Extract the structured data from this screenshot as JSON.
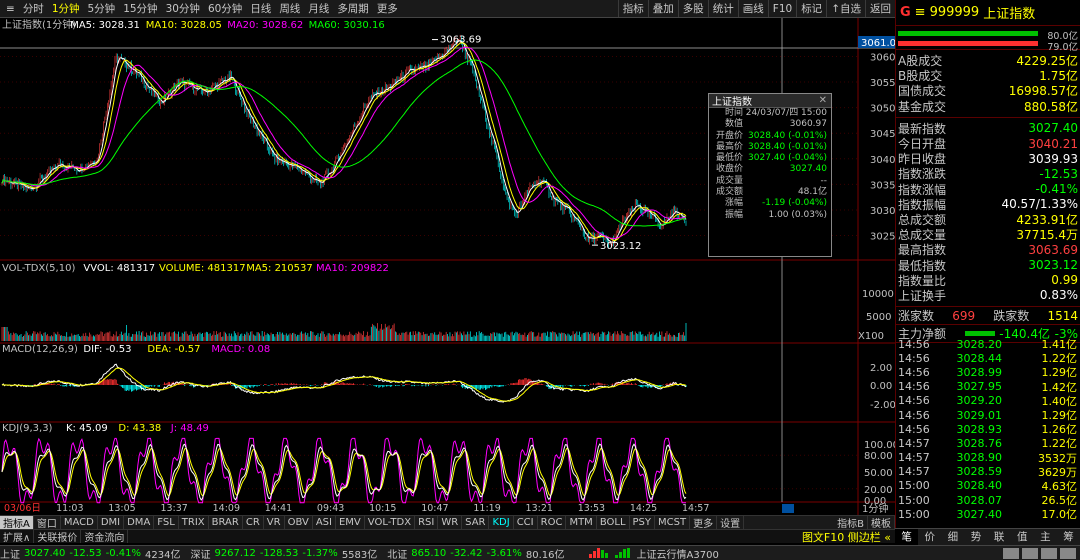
{
  "toolbar": {
    "menu_icon": "≡",
    "left": [
      "分时",
      "1分钟",
      "5分钟",
      "15分钟",
      "30分钟",
      "60分钟",
      "日线",
      "周线",
      "月线",
      "多周期",
      "更多"
    ],
    "active_index": 1,
    "right": [
      "指标",
      "叠加",
      "多股",
      "统计",
      "画线",
      "F10",
      "标记",
      "↑自选",
      "返回"
    ]
  },
  "main_legend": {
    "name": "上证指数(1分钟)",
    "ma5": "MA5: 3028.31",
    "ma10": "MA10: 3028.05",
    "ma20": "MA20: 3028.62",
    "ma60": "MA60: 3030.16"
  },
  "price_axis": {
    "ticks": [
      "3060",
      "3055",
      "3050",
      "3045",
      "3040",
      "3035",
      "3030",
      "3025"
    ],
    "highlight": "3061.0",
    "high_label": "3063.69",
    "low_label": "3023.12"
  },
  "vol_legend": {
    "name": "VOL-TDX(5,10)",
    "vvol": "VVOL: 481317",
    "volume": "VOLUME: 481317",
    "ma5": "MA5: 210537",
    "ma10": "MA10: 209822",
    "ticks": [
      "10000",
      "5000"
    ],
    "unit": "X100"
  },
  "macd_legend": {
    "name": "MACD(12,26,9)",
    "dif": "DIF: -0.53",
    "dea": "DEA: -0.57",
    "macd": "MACD: 0.08",
    "ticks": [
      "2.00",
      "0.00",
      "-2.00"
    ]
  },
  "kdj_legend": {
    "name": "KDJ(9,3,3)",
    "k": "K: 45.09",
    "d": "D: 43.38",
    "j": "J: 48.49",
    "ticks": [
      "100.00",
      "80.00",
      "50.00",
      "20.00",
      "0.00"
    ]
  },
  "time_axis": [
    "03/06日",
    "11:03",
    "13:05",
    "13:37",
    "14:09",
    "14:41",
    "09:43",
    "10:15",
    "10:47",
    "11:19",
    "13:21",
    "13:53",
    "14:25",
    "14:57"
  ],
  "period_label": "1分钟",
  "popup": {
    "title": "上证指数",
    "close": "✕",
    "rows": [
      {
        "k": "时间",
        "v": "24/03/07/四 15:00",
        "c": ""
      },
      {
        "k": "数值",
        "v": "3060.97",
        "c": ""
      },
      {
        "k": "开盘价",
        "v": "3028.40 (-0.01%)",
        "c": "g"
      },
      {
        "k": "最高价",
        "v": "3028.40 (-0.01%)",
        "c": "g"
      },
      {
        "k": "最低价",
        "v": "3027.40 (-0.04%)",
        "c": "g"
      },
      {
        "k": "收盘价",
        "v": "3027.40",
        "c": "g"
      },
      {
        "k": "成交量",
        "v": "--",
        "c": ""
      },
      {
        "k": "成交额",
        "v": "48.1亿",
        "c": ""
      },
      {
        "k": "涨幅",
        "v": "-1.19 (-0.04%)",
        "c": "g"
      },
      {
        "k": "振幅",
        "v": "1.00 (0.03%)",
        "c": ""
      }
    ]
  },
  "right_panel": {
    "badge": "G",
    "menu": "≡",
    "code": "999999",
    "name": "上证指数",
    "bar_pct_top": "80.0亿",
    "bar_pct_bottom": "79.0亿",
    "block1": [
      {
        "k": "A股成交",
        "v": "4229.25亿",
        "c": "yel"
      },
      {
        "k": "B股成交",
        "v": "1.75亿",
        "c": "yel"
      },
      {
        "k": "国债成交",
        "v": "16998.57亿",
        "c": "yel"
      },
      {
        "k": "基金成交",
        "v": "880.58亿",
        "c": "yel"
      }
    ],
    "block2": [
      {
        "k": "最新指数",
        "v": "3027.40",
        "c": "green"
      },
      {
        "k": "今日开盘",
        "v": "3040.21",
        "c": "red"
      },
      {
        "k": "昨日收盘",
        "v": "3039.93",
        "c": "white"
      },
      {
        "k": "指数涨跌",
        "v": "-12.53",
        "c": "green"
      },
      {
        "k": "指数涨幅",
        "v": "-0.41%",
        "c": "green"
      },
      {
        "k": "指数振幅",
        "v": "40.57/1.33%",
        "c": "white"
      },
      {
        "k": "总成交额",
        "v": "4233.91亿",
        "c": "yel"
      },
      {
        "k": "总成交量",
        "v": "37715.4万",
        "c": "yel"
      },
      {
        "k": "最高指数",
        "v": "3063.69",
        "c": "red"
      },
      {
        "k": "最低指数",
        "v": "3023.12",
        "c": "green"
      },
      {
        "k": "指数量比",
        "v": "0.99",
        "c": "yel"
      },
      {
        "k": "上证换手",
        "v": "0.83%",
        "c": "white"
      }
    ],
    "updown": {
      "up_label": "涨家数",
      "up": "699",
      "down_label": "跌家数",
      "down": "1514"
    },
    "netflow": {
      "label": "主力净额",
      "value": "-140.4亿",
      "pct": "-3%"
    },
    "ticks": [
      {
        "t": "14:56",
        "p": "3028.20",
        "v": "1.41亿"
      },
      {
        "t": "14:56",
        "p": "3028.44",
        "v": "1.22亿"
      },
      {
        "t": "14:56",
        "p": "3028.99",
        "v": "1.29亿"
      },
      {
        "t": "14:56",
        "p": "3027.95",
        "v": "1.42亿"
      },
      {
        "t": "14:56",
        "p": "3029.20",
        "v": "1.40亿"
      },
      {
        "t": "14:56",
        "p": "3029.01",
        "v": "1.29亿"
      },
      {
        "t": "14:56",
        "p": "3028.93",
        "v": "1.26亿"
      },
      {
        "t": "14:57",
        "p": "3028.76",
        "v": "1.22亿"
      },
      {
        "t": "14:57",
        "p": "3028.90",
        "v": "3532万"
      },
      {
        "t": "14:57",
        "p": "3028.59",
        "v": "3629万"
      },
      {
        "t": "15:00",
        "p": "3028.40",
        "v": "4.63亿"
      },
      {
        "t": "15:00",
        "p": "3028.07",
        "v": "26.5亿"
      },
      {
        "t": "15:00",
        "p": "3027.40",
        "v": "17.0亿"
      }
    ],
    "tabs": [
      "笔",
      "价",
      "细",
      "势",
      "联",
      "值",
      "主",
      "筹"
    ]
  },
  "indicator_tabs": [
    "指标A",
    "窗口",
    "MACD",
    "DMI",
    "DMA",
    "FSL",
    "TRIX",
    "BRAR",
    "CR",
    "VR",
    "OBV",
    "ASI",
    "EMV",
    "VOL-TDX",
    "RSI",
    "WR",
    "SAR",
    "KDJ",
    "CCI",
    "ROC",
    "MTM",
    "BOLL",
    "PSY",
    "MCST",
    "更多",
    "设置"
  ],
  "indicator_active": "KDJ",
  "indicator_right": [
    "指标B",
    "模板"
  ],
  "bar2": [
    "扩展∧",
    "关联报价",
    "资金流向"
  ],
  "bar2_right": "图文F10 侧边栏 «",
  "status": {
    "sh_label": "上证",
    "sh_val": "3027.40",
    "sh_chg": "-12.53",
    "sh_pct": "-0.41%",
    "sh_amt": "4234亿",
    "sz_label": "深证",
    "sz_val": "9267.12",
    "sz_chg": "-128.53",
    "sz_pct": "-1.37%",
    "sz_amt": "5583亿",
    "bz_label": "北证",
    "bz_val": "865.10",
    "bz_chg": "-32.42",
    "bz_pct": "-3.61%",
    "bz_amt": "80.16亿",
    "cloud": "上证云行情A3700"
  },
  "colors": {
    "up": "#ff4040",
    "down": "#00ff00",
    "ma5": "#ffffff",
    "ma10": "#ffff00",
    "ma20": "#ff00ff",
    "ma60": "#00ff00"
  }
}
